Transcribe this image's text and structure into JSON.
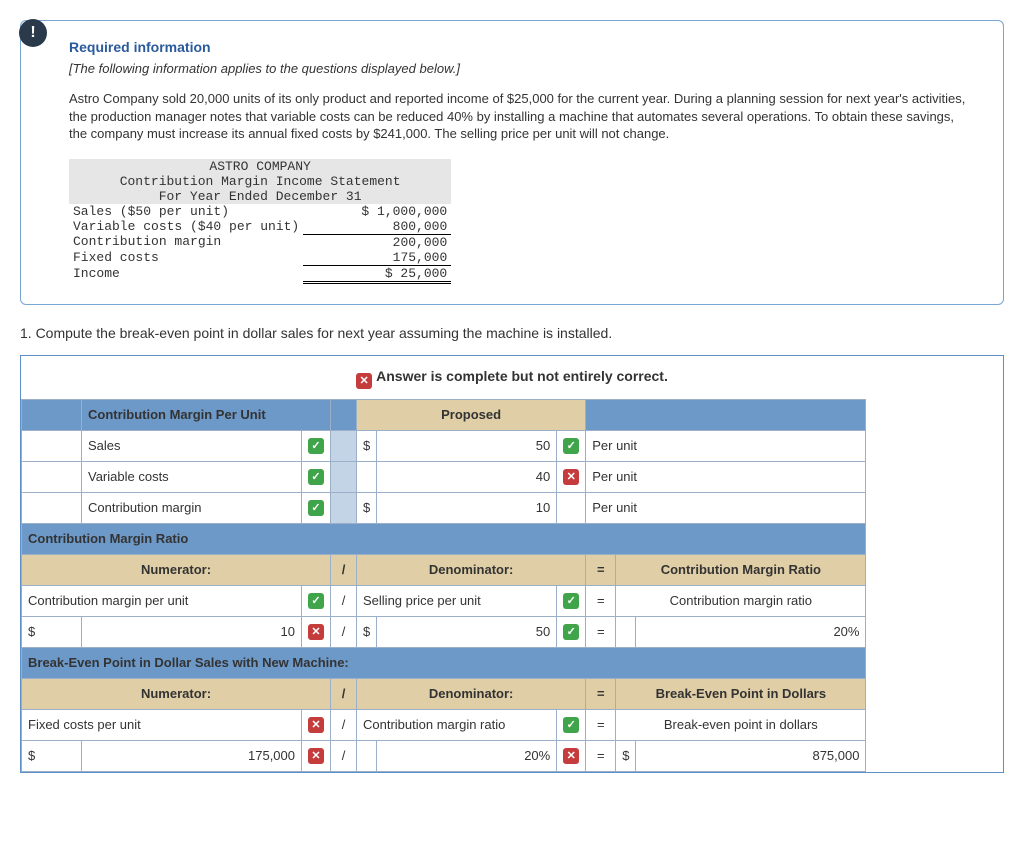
{
  "info": {
    "required_title": "Required information",
    "subtitle": "[The following information applies to the questions displayed below.]",
    "body": "Astro Company sold 20,000 units of its only product and reported income of $25,000 for the current year. During a planning session for next year's activities, the production manager notes that variable costs can be reduced 40% by installing a machine that automates several operations. To obtain these savings, the company must increase its annual fixed costs by $241,000. The selling price per unit will not change.",
    "stmt": {
      "company": "ASTRO COMPANY",
      "title": "Contribution Margin Income Statement",
      "period": "For Year Ended December 31",
      "rows": [
        {
          "label": "Sales ($50 per unit)",
          "value": "$ 1,000,000"
        },
        {
          "label": "Variable costs ($40 per unit)",
          "value": "800,000"
        },
        {
          "label": "Contribution margin",
          "value": "200,000"
        },
        {
          "label": "Fixed costs",
          "value": "175,000"
        },
        {
          "label": "Income",
          "value": "$ 25,000"
        }
      ]
    }
  },
  "question": "1. Compute the break-even point in dollar sales for next year assuming the machine is installed.",
  "status": "Answer is complete but not entirely correct.",
  "section": {
    "cmpu_header": "Contribution Margin Per Unit",
    "proposed": "Proposed",
    "rows": {
      "sales": {
        "label": "Sales",
        "dollar": "$",
        "val": "50",
        "status": "check",
        "unit_status": "check",
        "unit": "Per unit"
      },
      "varcost": {
        "label": "Variable costs",
        "val": "40",
        "status": "check",
        "unit_status": "x",
        "unit": "Per unit"
      },
      "cm": {
        "label": "Contribution margin",
        "dollar": "$",
        "val": "10",
        "status": "check",
        "unit": "Per unit"
      }
    },
    "cmr_header": "Contribution Margin Ratio",
    "numerator": "Numerator:",
    "denominator": "Denominator:",
    "cmr_result": "Contribution Margin Ratio",
    "cmr_row": {
      "num_label": "Contribution margin per unit",
      "num_status": "check",
      "den_label": "Selling price per unit",
      "den_status": "check",
      "res_label": "Contribution margin ratio"
    },
    "cmr_vals": {
      "num_dollar": "$",
      "num_val": "10",
      "num_status": "x",
      "den_dollar": "$",
      "den_val": "50",
      "den_status": "check",
      "res_val": "20%"
    },
    "be_header": "Break-Even Point in Dollar Sales with New Machine:",
    "be_result": "Break-Even Point in Dollars",
    "be_row": {
      "num_label": "Fixed costs per unit",
      "num_status": "x",
      "den_label": "Contribution margin ratio",
      "den_status": "check",
      "res_label": "Break-even point in dollars"
    },
    "be_vals": {
      "num_dollar": "$",
      "num_val": "175,000",
      "num_status": "x",
      "den_val": "20%",
      "den_status": "x",
      "res_dollar": "$",
      "res_val": "875,000"
    },
    "slash": "/",
    "equals": "="
  },
  "chart_data": {
    "type": "table",
    "title": "Contribution Margin / Break-Even Computation",
    "income_statement": {
      "Sales ($50 per unit)": 1000000,
      "Variable costs ($40 per unit)": 800000,
      "Contribution margin": 200000,
      "Fixed costs": 175000,
      "Income": 25000
    },
    "proposed_per_unit": {
      "Sales": 50,
      "Variable costs": 40,
      "Contribution margin": 10
    },
    "contribution_margin_ratio": {
      "numerator": 10,
      "denominator": 50,
      "result_pct": 20
    },
    "break_even_dollars": {
      "fixed_costs": 175000,
      "cm_ratio_pct": 20,
      "result": 875000
    }
  }
}
